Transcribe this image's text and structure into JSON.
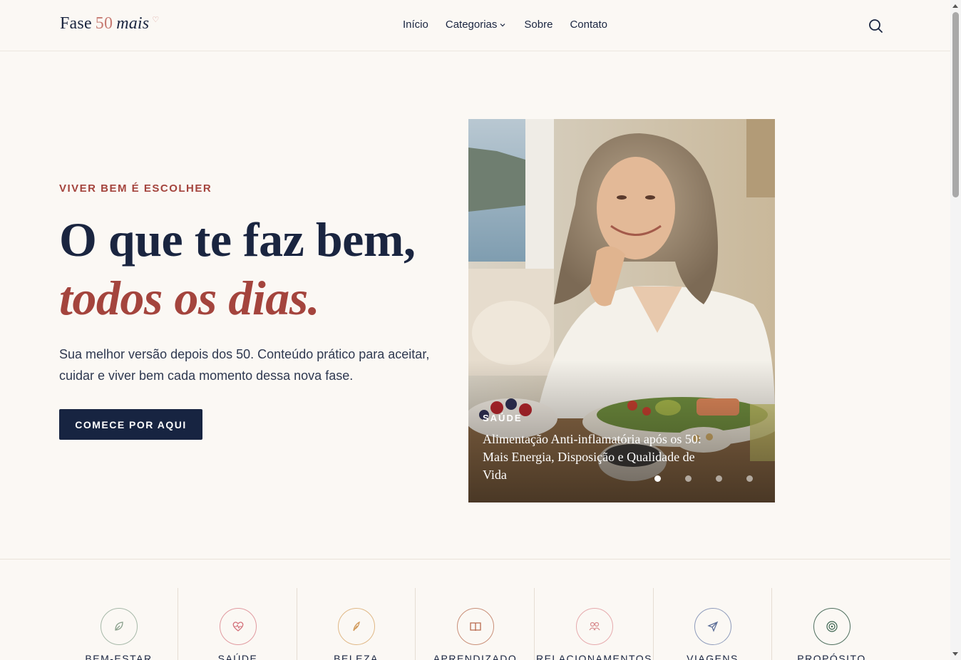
{
  "header": {
    "logo": {
      "word": "Fase",
      "number": "50",
      "suffix": "mais",
      "heart": "♡"
    },
    "nav": [
      {
        "label": "Início"
      },
      {
        "label": "Categorias",
        "has_dropdown": true
      },
      {
        "label": "Sobre"
      },
      {
        "label": "Contato"
      }
    ],
    "search_icon": "search-icon"
  },
  "hero": {
    "eyebrow": "VIVER BEM É ESCOLHER",
    "headline_line1": "O que te faz bem,",
    "headline_line2": "todos os dias.",
    "lead": "Sua melhor versão depois dos 50. Conteúdo prático para aceitar, cuidar e viver bem cada momento dessa nova fase.",
    "cta_label": "COMECE POR AQUI"
  },
  "featured": {
    "category": "SAÚDE",
    "title": "Alimentação Anti-inflamatória após os 50: Mais Energia, Disposição e Qualidade de Vida",
    "slides_total": 4,
    "active_slide": 1
  },
  "categories": [
    {
      "label": "BEM-ESTAR",
      "icon": "leaf-icon",
      "color": "#8aa08c"
    },
    {
      "label": "SAÚDE",
      "icon": "heart-pulse-icon",
      "color": "#d3707a"
    },
    {
      "label": "BELEZA",
      "icon": "feather-icon",
      "color": "#d29a5c"
    },
    {
      "label": "APRENDIZADO",
      "icon": "book-icon",
      "color": "#b86a4e"
    },
    {
      "label": "RELACIONAMENTOS",
      "icon": "people-icon",
      "color": "#d88a8d"
    },
    {
      "label": "VIAGENS",
      "icon": "plane-icon",
      "color": "#5d6f98"
    },
    {
      "label": "PROPÓSITO",
      "icon": "target-icon",
      "color": "#3f6652"
    }
  ],
  "colors": {
    "navy": "#172441",
    "accent": "#a4443d",
    "background": "#fbf8f4"
  }
}
